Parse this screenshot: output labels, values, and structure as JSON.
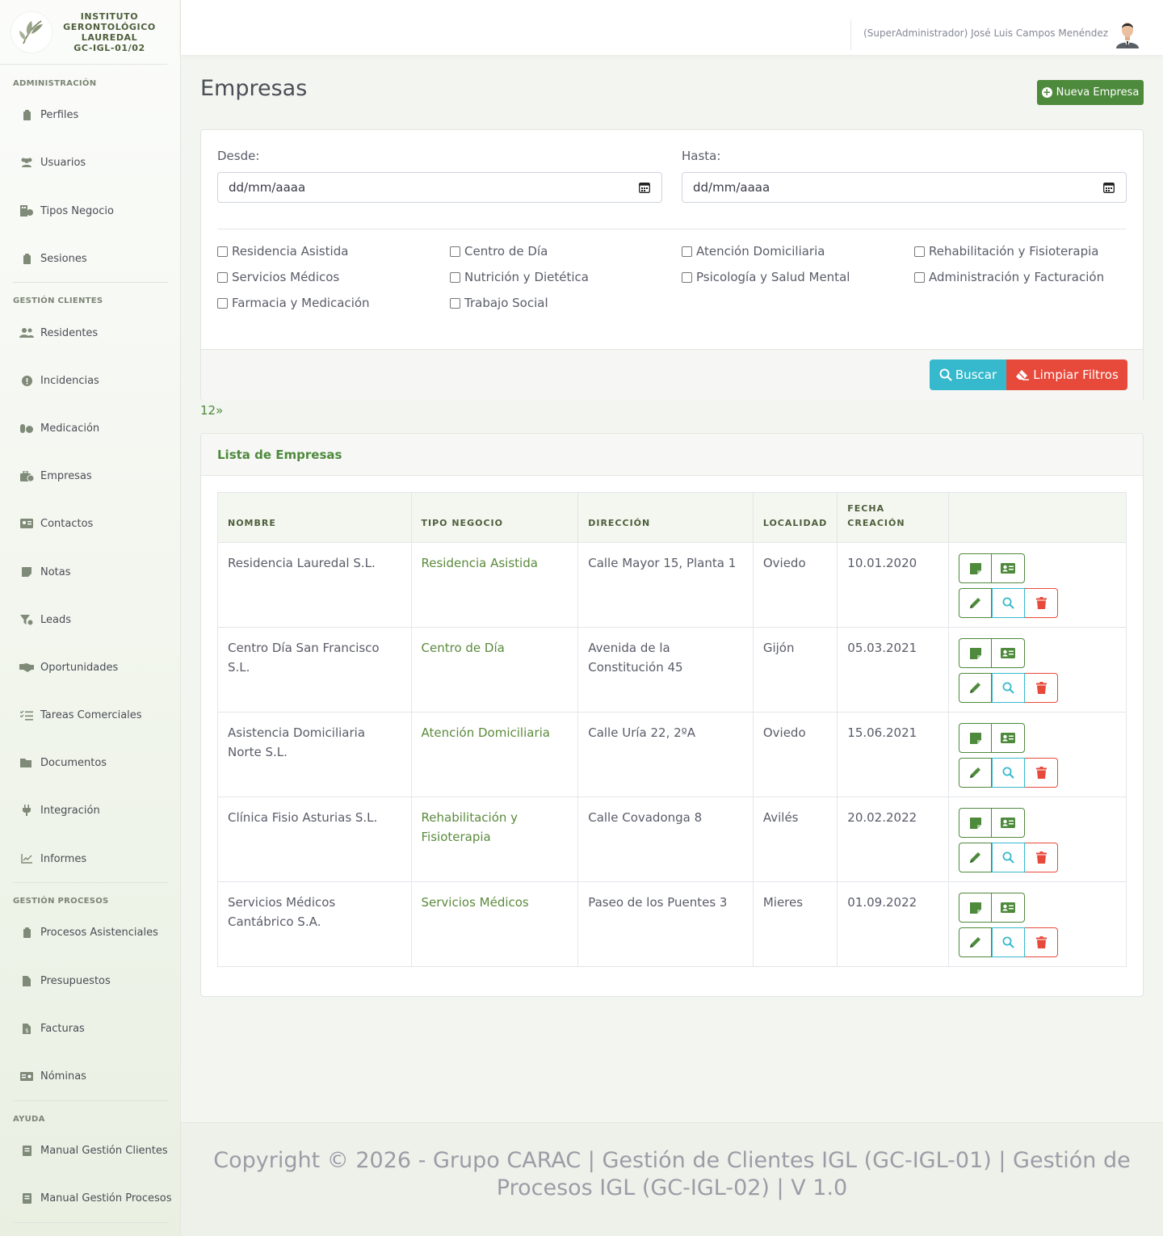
{
  "brand": {
    "line1": "INSTITUTO",
    "line2": "GERONTOLÓGICO",
    "line3": "LAUREDAL",
    "line4": "GC-IGL-01/02"
  },
  "sidebar": {
    "sections": [
      {
        "title": "ADMINISTRACIÓN"
      },
      {
        "title": "GESTIÓN CLIENTES"
      },
      {
        "title": "GESTIÓN PROCESOS"
      },
      {
        "title": "AYUDA"
      }
    ],
    "items": [
      {
        "label": "Perfiles",
        "icon": "clipboard-icon"
      },
      {
        "label": "Usuarios",
        "icon": "users-icon"
      },
      {
        "label": "Tipos Negocio",
        "icon": "building-icon"
      },
      {
        "label": "Sesiones",
        "icon": "clipboard-icon"
      },
      {
        "label": "Residentes",
        "icon": "users-icon"
      },
      {
        "label": "Incidencias",
        "icon": "alert-icon"
      },
      {
        "label": "Medicación",
        "icon": "pills-icon"
      },
      {
        "label": "Empresas",
        "icon": "briefcase-icon"
      },
      {
        "label": "Contactos",
        "icon": "id-card-icon"
      },
      {
        "label": "Notas",
        "icon": "note-icon"
      },
      {
        "label": "Leads",
        "icon": "funnel-icon"
      },
      {
        "label": "Oportunidades",
        "icon": "handshake-icon"
      },
      {
        "label": "Tareas Comerciales",
        "icon": "tasks-icon"
      },
      {
        "label": "Documentos",
        "icon": "folder-icon"
      },
      {
        "label": "Integración",
        "icon": "plug-icon"
      },
      {
        "label": "Informes",
        "icon": "chart-icon"
      },
      {
        "label": "Procesos Asistenciales",
        "icon": "clipboard-icon"
      },
      {
        "label": "Presupuestos",
        "icon": "file-icon"
      },
      {
        "label": "Facturas",
        "icon": "invoice-icon"
      },
      {
        "label": "Nóminas",
        "icon": "money-icon"
      },
      {
        "label": "Manual Gestión Clientes",
        "icon": "book-icon"
      },
      {
        "label": "Manual Gestión Procesos",
        "icon": "book-icon"
      }
    ]
  },
  "topbar": {
    "user": "(SuperAdministrador) José Luis Campos Menéndez"
  },
  "page": {
    "title": "Empresas",
    "new_button": "Nueva Empresa"
  },
  "filters": {
    "desde_label": "Desde:",
    "hasta_label": "Hasta:",
    "desde_value": "dd/mm/aaaa",
    "hasta_value": "dd/mm/aaaa",
    "checkboxes": [
      "Residencia Asistida",
      "Centro de Día",
      "Atención Domiciliaria",
      "Rehabilitación y Fisioterapia",
      "Servicios Médicos",
      "Nutrición y Dietética",
      "Psicología y Salud Mental",
      "Administración y Facturación",
      "Farmacia y Medicación",
      "Trabajo Social"
    ],
    "search_button": "Buscar",
    "clear_button": "Limpiar Filtros"
  },
  "pagination": "12»",
  "list": {
    "title": "Lista de Empresas",
    "columns": [
      "NOMBRE",
      "TIPO NEGOCIO",
      "DIRECCIÓN",
      "LOCALIDAD",
      "FECHA CREACIÓN",
      ""
    ],
    "rows": [
      {
        "nombre": "Residencia Lauredal S.L.",
        "tipo": "Residencia Asistida",
        "direccion": "Calle Mayor 15, Planta 1",
        "localidad": "Oviedo",
        "fecha": "10.01.2020"
      },
      {
        "nombre": "Centro Día San Francisco S.L.",
        "tipo": "Centro de Día",
        "direccion": "Avenida de la Constitución 45",
        "localidad": "Gijón",
        "fecha": "05.03.2021"
      },
      {
        "nombre": "Asistencia Domiciliaria Norte S.L.",
        "tipo": "Atención Domiciliaria",
        "direccion": "Calle Uría 22, 2ºA",
        "localidad": "Oviedo",
        "fecha": "15.06.2021"
      },
      {
        "nombre": "Clínica Fisio Asturias S.L.",
        "tipo": "Rehabilitación y Fisioterapia",
        "direccion": "Calle Covadonga 8",
        "localidad": "Avilés",
        "fecha": "20.02.2022"
      },
      {
        "nombre": "Servicios Médicos Cantábrico S.A.",
        "tipo": "Servicios Médicos",
        "direccion": "Paseo de los Puentes 3",
        "localidad": "Mieres",
        "fecha": "01.09.2022"
      }
    ]
  },
  "footer": {
    "text": "Copyright © 2026 - Grupo CARAC | Gestión de Clientes IGL (GC-IGL-01) | Gestión de Procesos IGL (GC-IGL-02) | V 1.0"
  },
  "colors": {
    "primary": "#4e8a3c",
    "info": "#36b9cc",
    "danger": "#e74a3b"
  }
}
